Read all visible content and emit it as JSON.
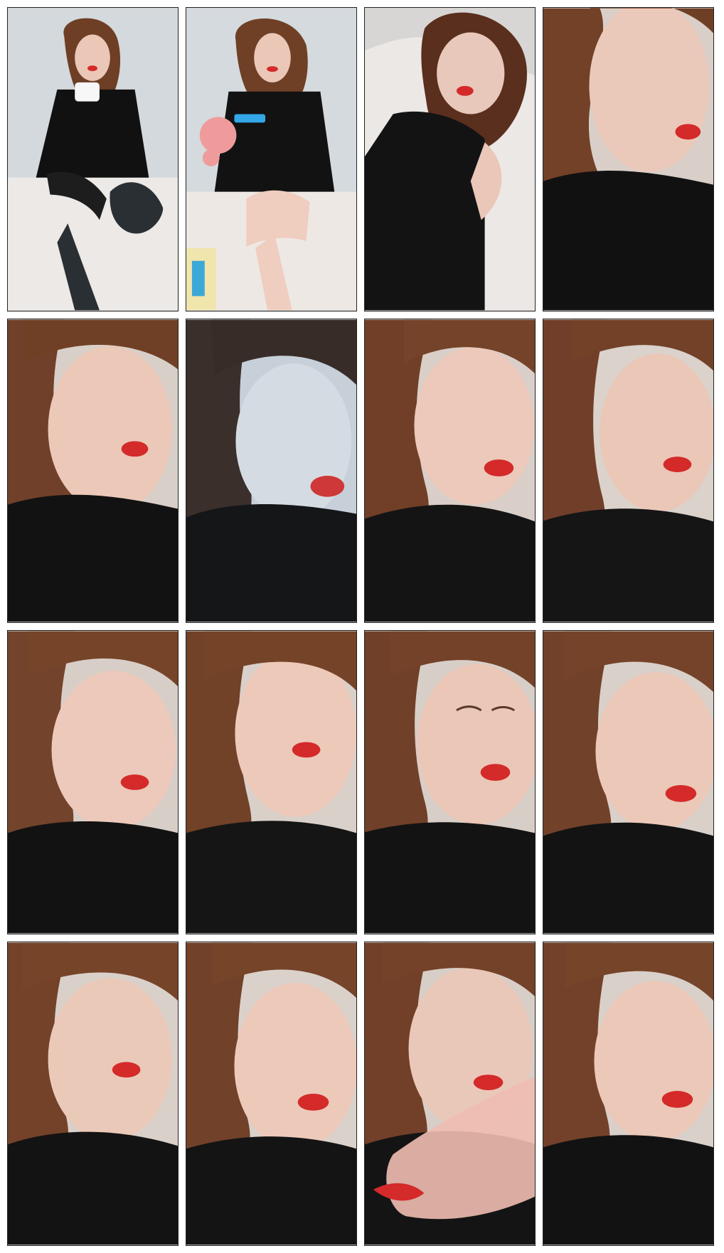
{
  "contact_sheet": {
    "layout": {
      "columns": 4,
      "rows": 4,
      "frame_count": 16
    },
    "frames": [
      {
        "index": 1,
        "scene": "full-body-seated-holding-tissue",
        "tone": "cool"
      },
      {
        "index": 2,
        "scene": "full-body-seated-holding-pink-item",
        "tone": "cool"
      },
      {
        "index": 3,
        "scene": "lying-on-bed-portrait",
        "tone": "warm"
      },
      {
        "index": 4,
        "scene": "close-up-face",
        "tone": "warm"
      },
      {
        "index": 5,
        "scene": "close-up-face",
        "tone": "warm"
      },
      {
        "index": 6,
        "scene": "close-up-face-blue-tint",
        "tone": "cool"
      },
      {
        "index": 7,
        "scene": "close-up-face",
        "tone": "warm"
      },
      {
        "index": 8,
        "scene": "close-up-face",
        "tone": "warm"
      },
      {
        "index": 9,
        "scene": "close-up-face",
        "tone": "warm"
      },
      {
        "index": 10,
        "scene": "close-up-face",
        "tone": "warm"
      },
      {
        "index": 11,
        "scene": "close-up-face-eyes-closed",
        "tone": "warm"
      },
      {
        "index": 12,
        "scene": "close-up-face",
        "tone": "warm"
      },
      {
        "index": 13,
        "scene": "close-up-face",
        "tone": "warm"
      },
      {
        "index": 14,
        "scene": "close-up-face",
        "tone": "warm"
      },
      {
        "index": 15,
        "scene": "close-up-face-hand-in-front",
        "tone": "warm"
      },
      {
        "index": 16,
        "scene": "close-up-face",
        "tone": "warm"
      }
    ],
    "colors": {
      "background": "#ffffff",
      "frame_border": "#222222",
      "skin": "#e7c2b2",
      "hair": "#6f3f24",
      "outfit": "#111111",
      "lips": "#d42a2a",
      "cool_wall": "#d2d8de",
      "warm_wall": "#d8cdc4"
    }
  }
}
